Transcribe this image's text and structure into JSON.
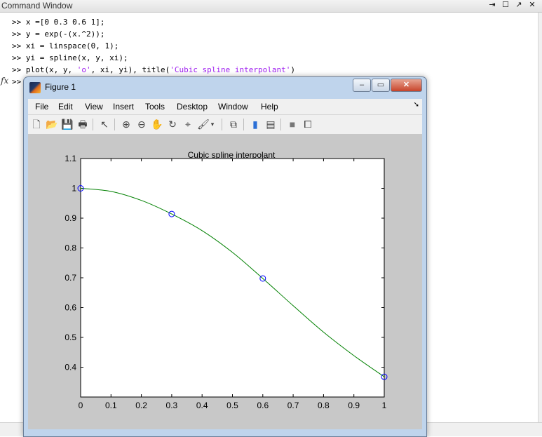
{
  "command_window": {
    "title": "Command Window",
    "controls": [
      "undock-icon",
      "maximize-icon",
      "popout-icon",
      "close-icon"
    ],
    "lines": [
      {
        "prompt": ">>",
        "code": "x =[0 0.3 0.6 1];"
      },
      {
        "prompt": ">>",
        "code": "y = exp(-(x.^2));"
      },
      {
        "prompt": ">>",
        "code": "xi = linspace(0, 1);"
      },
      {
        "prompt": ">>",
        "code": "yi = spline(x, y, xi);"
      },
      {
        "prompt": ">>",
        "code_before": "plot(x, y, ",
        "str1": "'o'",
        "code_mid": ", xi, yi), title(",
        "str2": "'Cubic spline interpolant'",
        "code_after": ")"
      }
    ],
    "fx_label": "fx",
    "current_prompt": ">>"
  },
  "figure": {
    "title": "Figure 1",
    "menu": [
      "File",
      "Edit",
      "View",
      "Insert",
      "Tools",
      "Desktop",
      "Window",
      "Help"
    ],
    "toolbar_icons": [
      "new-figure-icon",
      "open-file-icon",
      "save-icon",
      "print-icon",
      "edit-plot-arrow-icon",
      "zoom-in-icon",
      "zoom-out-icon",
      "pan-hand-icon",
      "rotate-3d-icon",
      "data-cursor-icon",
      "brush-icon",
      "brush-dropdown-icon",
      "link-plot-icon",
      "colorbar-icon",
      "legend-icon",
      "hide-plot-tools-icon",
      "show-plot-tools-icon"
    ]
  },
  "chart_data": {
    "type": "line",
    "title": "Cubic spline interpolant",
    "xlabel": "",
    "ylabel": "",
    "xlim": [
      0,
      1
    ],
    "ylim": [
      0.3,
      1.1
    ],
    "xticks": [
      "0",
      "0.1",
      "0.2",
      "0.3",
      "0.4",
      "0.5",
      "0.6",
      "0.7",
      "0.8",
      "0.9",
      "1"
    ],
    "yticks": [
      "0.4",
      "0.5",
      "0.6",
      "0.7",
      "0.8",
      "0.9",
      "1",
      "1.1"
    ],
    "series": [
      {
        "marker": "circle",
        "color": "#0000ff",
        "x": [
          0,
          0.3,
          0.6,
          1
        ],
        "y": [
          1.0,
          0.9139,
          0.6977,
          0.3679
        ]
      },
      {
        "marker": "none",
        "color": "#008000",
        "x": [
          0,
          0.1,
          0.2,
          0.3,
          0.4,
          0.5,
          0.6,
          0.7,
          0.8,
          0.9,
          1.0
        ],
        "y": [
          1.0,
          0.9898,
          0.9595,
          0.9139,
          0.8582,
          0.7852,
          0.6977,
          0.6064,
          0.5176,
          0.4389,
          0.3679
        ]
      }
    ],
    "grid": false
  }
}
